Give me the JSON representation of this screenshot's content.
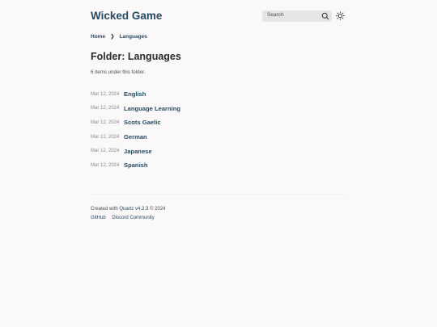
{
  "header": {
    "site_title": "Wicked Game",
    "search_placeholder": "Search",
    "search_icon": "search-icon",
    "theme_icon": "sun-icon"
  },
  "breadcrumb": {
    "items": [
      "Home"
    ],
    "separator": "❯",
    "current": "Languages"
  },
  "main": {
    "title": "Folder: Languages",
    "item_count": "6 items under this folder.",
    "items": [
      {
        "date": "Mar 12, 2024",
        "title": "English"
      },
      {
        "date": "Mar 12, 2024",
        "title": "Language Learning"
      },
      {
        "date": "Mar 12, 2024",
        "title": "Scots Gaelic"
      },
      {
        "date": "Mar 12, 2024",
        "title": "German"
      },
      {
        "date": "Mar 12, 2024",
        "title": "Japanese"
      },
      {
        "date": "Mar 12, 2024",
        "title": "Spanish"
      }
    ]
  },
  "footer": {
    "credit_prefix": "Created with ",
    "credit_link": "Quartz v4.2.3",
    "credit_suffix": " © 2024",
    "links": [
      "GitHub",
      "Discord Community"
    ]
  },
  "colors": {
    "accent": "#284b63",
    "background": "#faf8f8",
    "text": "#2b2b2b"
  }
}
